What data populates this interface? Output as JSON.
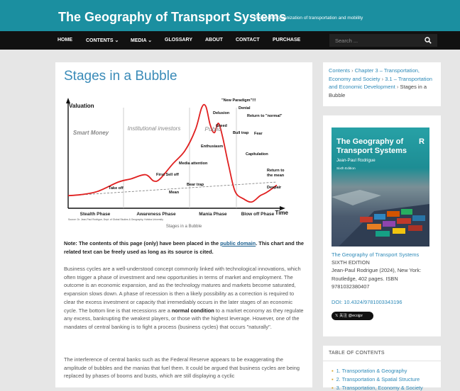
{
  "site": {
    "title": "The Geography of Transport Systems",
    "tagline": "The spatial organization of transportation and mobility"
  },
  "nav": {
    "items": [
      {
        "key": "home",
        "label": "HOME"
      },
      {
        "key": "contents",
        "label": "CONTENTS ⌄"
      },
      {
        "key": "media",
        "label": "MEDIA ⌄"
      },
      {
        "key": "glossary",
        "label": "GLOSSARY"
      },
      {
        "key": "about",
        "label": "ABOUT"
      },
      {
        "key": "contact",
        "label": "CONTACT"
      },
      {
        "key": "purchase",
        "label": "PURCHASE"
      }
    ],
    "search_placeholder": "Search ..."
  },
  "article": {
    "title": "Stages in a Bubble",
    "caption": "Stages in a Bubble",
    "note_pre": "Note: The contents of this page (only) have been placed in the ",
    "note_link": "public domain",
    "note_post": ". This chart and the related text can be freely used as long as its source is cited.",
    "p1_a": "Business cycles are a well-understood concept commonly linked with technological innovations, which often trigger a phase of investment and new opportunities in terms of market and employment. The outcome is an economic expansion, and as the technology matures and markets become saturated, expansion slows down. A phase of recession is then a likely possibility as a correction is required to clear the excess investment or capacity that irremediably occurs in the later stages of an economic cycle. The bottom line is that recessions are a ",
    "p1_bold": "normal condition",
    "p1_b": " to a market economy as they regulate any excess, bankrupting the weakest players, or those with the highest leverage. However, one of the mandates of central banking is to fight a process (business cycles) that occurs \"naturally\".",
    "p2": "The interference of central banks such as the Federal Reserve appears to be exaggerating the amplitude of bubbles and the manias that fuel them. It could be argued that business cycles are being replaced by phases of booms and busts, which are still displaying a cyclic"
  },
  "chart_data": {
    "type": "line",
    "title": "",
    "ylabel": "Valuation",
    "xlabel": "Time",
    "phases": [
      "Stealth Phase",
      "Awareness Phase",
      "Mania Phase",
      "Blow off Phase"
    ],
    "zones": [
      "Smart Money",
      "Institutional investors",
      "Public"
    ],
    "annotations": [
      "\"New Paradigm\"!!!",
      "Delusion",
      "Denial",
      "Return to \"normal\"",
      "Greed",
      "Bull trap",
      "Fear",
      "Enthusiasm",
      "Capitulation",
      "Media attention",
      "First Sell off",
      "Take off",
      "Bear trap",
      "Mean",
      "Return to the mean",
      "Despair"
    ],
    "source": "Source: Dr. Jean-Paul Rodrigue, Dept. of Global Studies & Geography, Hofstra University",
    "x": [
      0,
      6,
      14,
      24,
      30,
      37,
      41,
      44,
      50,
      56,
      61,
      64,
      66,
      68,
      70,
      72,
      74,
      77,
      80,
      84,
      88,
      92,
      95,
      100
    ],
    "y": [
      12,
      13,
      16,
      25,
      28,
      32,
      26,
      28,
      42,
      55,
      75,
      96,
      97,
      80,
      72,
      81,
      68,
      40,
      16,
      9,
      6,
      12,
      15,
      22
    ],
    "trend_y": [
      12,
      25
    ],
    "colors": {
      "curve": "#e02020",
      "trend": "#777777"
    }
  },
  "breadcrumbs": {
    "items": [
      {
        "label": "Contents"
      },
      {
        "label": "Chapter 3 – Transportation, Economy and Society"
      },
      {
        "label": "3.1 – Transportation and Economic Development"
      }
    ],
    "current": "Stages in a Bubble"
  },
  "book": {
    "cover_title": "The Geography of Transport Systems",
    "cover_author": "Jean-Paul Rodrigue",
    "cover_edition": "Sixth Edition",
    "cover_logo": "R",
    "link_title": "The Geography of Transport Systems",
    "edition": "SIXTH EDITION",
    "citation": "Jean-Paul Rodrigue (2024), New York: Routledge, 402 pages. ISBN 9781032380407",
    "doi": "DOI: 10.4324/9781003343196",
    "follow_label": "𝕏 关注 @ecojpr"
  },
  "toc": {
    "heading": "TABLE OF CONTENTS",
    "items": [
      {
        "label": "1. Transportation & Geography"
      },
      {
        "label": "2. Transportation & Spatial Structure"
      },
      {
        "label": "3. Transportation, Economy & Society"
      }
    ]
  },
  "colors": {
    "brand": "#1b8fa0",
    "nav_bg": "#111111",
    "link": "#2e8ab8"
  }
}
